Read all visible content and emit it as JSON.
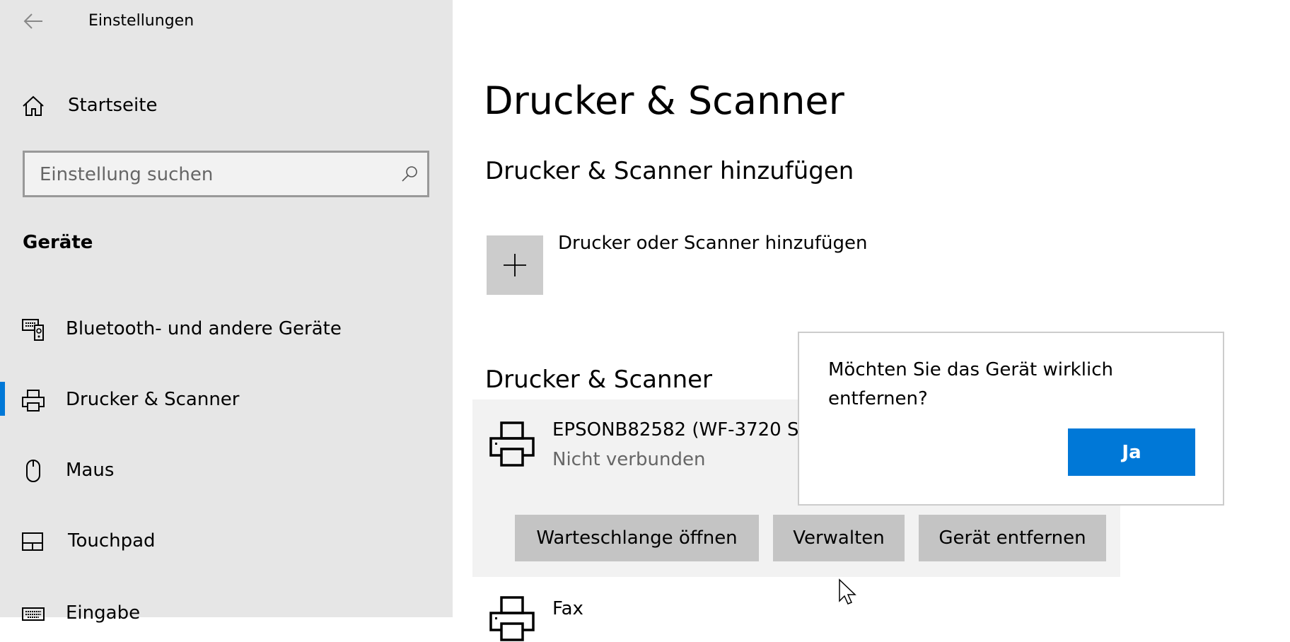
{
  "window": {
    "title": "Einstellungen",
    "back_icon": "arrow-left-icon"
  },
  "sidebar": {
    "home_label": "Startseite",
    "search_placeholder": "Einstellung suchen",
    "section_title": "Geräte",
    "items": [
      {
        "label": "Bluetooth- und andere Geräte",
        "icon": "bluetooth-devices-icon"
      },
      {
        "label": "Drucker & Scanner",
        "icon": "printer-icon",
        "selected": true
      },
      {
        "label": "Maus",
        "icon": "mouse-icon"
      },
      {
        "label": "Touchpad",
        "icon": "touchpad-icon"
      },
      {
        "label": "Eingabe",
        "icon": "keyboard-icon"
      }
    ],
    "accent": "#0078d7"
  },
  "main": {
    "title": "Drucker & Scanner",
    "add_section_title": "Drucker & Scanner hinzufügen",
    "add_label": "Drucker oder Scanner hinzufügen",
    "list_title": "Drucker & Scanner",
    "devices": [
      {
        "name": "EPSONB82582 (WF-3720 Series)",
        "status": "Nicht verbunden"
      },
      {
        "name": "Fax"
      }
    ],
    "actions": {
      "queue": "Warteschlange öffnen",
      "manage": "Verwalten",
      "remove": "Gerät entfernen"
    }
  },
  "dialog": {
    "message": "Möchten Sie das Gerät wirklich entfernen?",
    "confirm": "Ja",
    "confirm_color": "#0078d7"
  }
}
